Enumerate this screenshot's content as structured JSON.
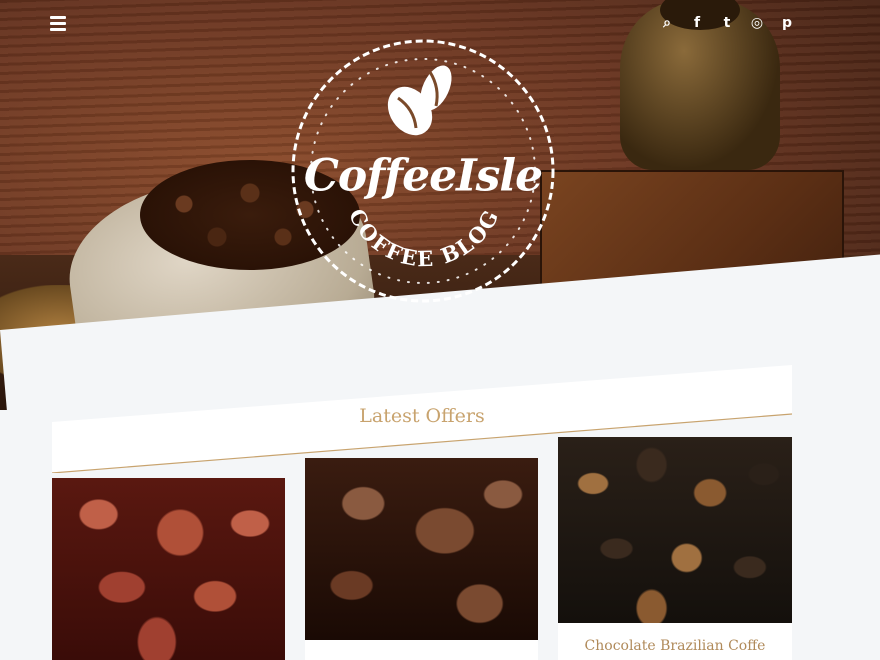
{
  "header": {
    "menu_icon": "hamburger-menu-icon",
    "social_links": [
      {
        "name": "search-icon",
        "glyph": "⌕"
      },
      {
        "name": "facebook-icon",
        "glyph": "f"
      },
      {
        "name": "twitter-icon",
        "glyph": "t"
      },
      {
        "name": "instagram-icon",
        "glyph": "◎"
      },
      {
        "name": "pinterest-icon",
        "glyph": "p"
      }
    ]
  },
  "logo": {
    "name": "CoffeeIsle",
    "tagline": "COFFEE BLOG"
  },
  "offers": {
    "title": "Latest Offers",
    "items": [
      {
        "caption": ""
      },
      {
        "caption": ""
      },
      {
        "caption": "Chocolate Brazilian Coffe"
      }
    ]
  },
  "colors": {
    "accent": "#c8a36e",
    "background": "#f4f6f8"
  }
}
